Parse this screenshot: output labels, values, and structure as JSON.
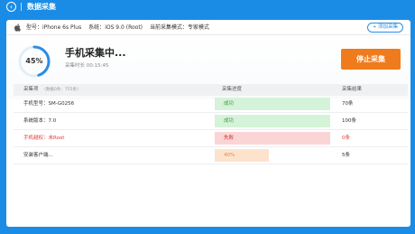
{
  "window": {
    "title": "数据采集"
  },
  "device": {
    "model_label": "型号：",
    "model": "iPhone 6s Plus",
    "os_label": "系统：",
    "os": "iOS 9.0 (Root)",
    "mode_label": "当前采集模式：",
    "mode": "专家模式",
    "add_button": "+ 添加采集"
  },
  "status": {
    "progress_text": "45%",
    "progress_value": 0.45,
    "title": "手机采集中...",
    "elapsed": "采集时长 00:15:45",
    "stop_button": "停止采集"
  },
  "table": {
    "headers": {
      "item": "采集项",
      "item_note": "（数据0条：755条）",
      "progress": "采集进度",
      "result": "采集结果"
    },
    "rows": [
      {
        "item": "手机型号：SM-G0256",
        "progress": "成功",
        "result": "70条"
      },
      {
        "item": "系统版本：7.0",
        "progress": "成功",
        "result": "100条"
      },
      {
        "item": "手机越权：未Root",
        "progress": "失败",
        "result": "0条"
      },
      {
        "item": "安装客户端...",
        "progress": "40%",
        "progress_value": 0.4,
        "result": "5条"
      }
    ]
  },
  "colors": {
    "accent": "#1a8ce6",
    "stop": "#f07b1c",
    "success": "#3a9a4a",
    "fail": "#d03030",
    "progress": "#e08a3a"
  },
  "icons": {
    "back": "back-arrow-icon",
    "device": "apple-icon"
  }
}
